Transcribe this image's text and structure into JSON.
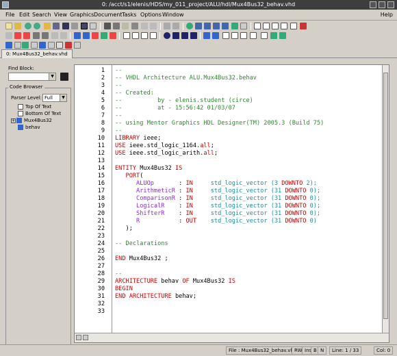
{
  "window": {
    "title": "0: /acct/s1/elenis/HDS/my_011_project/ALU/hdl/Mux4Bus32_behav.vhd"
  },
  "menu": [
    "File",
    "Edit",
    "Search",
    "View",
    "Graphics",
    "Document",
    "Tasks",
    "Options",
    "Window"
  ],
  "menu_help": "Help",
  "tab": {
    "label": "0: Mux4Bus32_behav.vhd"
  },
  "left_panel": {
    "find_block_label": "Find Block:",
    "code_browser_label": "Code Browser",
    "parser_level_label": "Parser Level:",
    "parser_level_value": "Full",
    "tree": [
      {
        "label": "Top Of Text",
        "icon": "page-icon"
      },
      {
        "label": "Bottom Of Text",
        "icon": "page-icon"
      },
      {
        "label": "Mux4Bus32",
        "icon": "entity-icon"
      },
      {
        "label": "behav",
        "icon": "architecture-icon"
      }
    ]
  },
  "editor": {
    "line_numbers": [
      "1",
      "2",
      "3",
      "4",
      "5",
      "6",
      "7",
      "8",
      "9",
      "10",
      "11",
      "12",
      "13",
      "14",
      "15",
      "16",
      "17",
      "18",
      "19",
      "20",
      "21",
      "22",
      "23",
      "24",
      "25",
      "26",
      "27",
      "28",
      "29",
      "30",
      "31",
      "32",
      "33"
    ],
    "lines": [
      [
        [
          "--",
          "com"
        ]
      ],
      [
        [
          "-- VHDL Architecture ALU.Mux4Bus32.behav",
          "com"
        ]
      ],
      [
        [
          "--",
          "com"
        ]
      ],
      [
        [
          "-- Created:",
          "com"
        ]
      ],
      [
        [
          "--          by - elenis.student (circe)",
          "com"
        ]
      ],
      [
        [
          "--          at - 15:56:42 01/03/07",
          "com"
        ]
      ],
      [
        [
          "--",
          "com"
        ]
      ],
      [
        [
          "-- using Mentor Graphics HDL Designer(TM) 2005.3 (Build 75)",
          "com"
        ]
      ],
      [
        [
          "--",
          "com"
        ]
      ],
      [
        [
          "LIBRARY",
          "kw"
        ],
        [
          " ieee;",
          "id"
        ]
      ],
      [
        [
          "USE",
          "kw"
        ],
        [
          " ieee.std_logic_1164.",
          "id"
        ],
        [
          "all",
          "kw"
        ],
        [
          ";",
          "id"
        ]
      ],
      [
        [
          "USE",
          "kw"
        ],
        [
          " ieee.std_logic_arith.",
          "id"
        ],
        [
          "all",
          "kw"
        ],
        [
          ";",
          "id"
        ]
      ],
      [],
      [
        [
          "ENTITY",
          "kw"
        ],
        [
          " Mux4Bus32 ",
          "id"
        ],
        [
          "IS",
          "kw"
        ]
      ],
      [
        [
          "   ",
          "id"
        ],
        [
          "PORT",
          "kw"
        ],
        [
          "(",
          "id"
        ]
      ],
      [
        [
          "      ",
          "id"
        ],
        [
          "ALUOp",
          "pt"
        ],
        [
          "       : ",
          "id"
        ],
        [
          "IN",
          "kw"
        ],
        [
          "     ",
          "id"
        ],
        [
          "std_logic_vector",
          "ty"
        ],
        [
          " (3 ",
          "num"
        ],
        [
          "DOWNTO",
          "kw"
        ],
        [
          " 2);",
          "num"
        ]
      ],
      [
        [
          "      ",
          "id"
        ],
        [
          "ArithmeticR",
          "pt"
        ],
        [
          " : ",
          "id"
        ],
        [
          "IN",
          "kw"
        ],
        [
          "     ",
          "id"
        ],
        [
          "std_logic_vector",
          "ty"
        ],
        [
          " (31 ",
          "num"
        ],
        [
          "DOWNTO",
          "kw"
        ],
        [
          " 0);",
          "num"
        ]
      ],
      [
        [
          "      ",
          "id"
        ],
        [
          "ComparisonR",
          "pt"
        ],
        [
          " : ",
          "id"
        ],
        [
          "IN",
          "kw"
        ],
        [
          "     ",
          "id"
        ],
        [
          "std_logic_vector",
          "ty"
        ],
        [
          " (31 ",
          "num"
        ],
        [
          "DOWNTO",
          "kw"
        ],
        [
          " 0);",
          "num"
        ]
      ],
      [
        [
          "      ",
          "id"
        ],
        [
          "LogicalR",
          "pt"
        ],
        [
          "    : ",
          "id"
        ],
        [
          "IN",
          "kw"
        ],
        [
          "     ",
          "id"
        ],
        [
          "std_logic_vector",
          "ty"
        ],
        [
          " (31 ",
          "num"
        ],
        [
          "DOWNTO",
          "kw"
        ],
        [
          " 0);",
          "num"
        ]
      ],
      [
        [
          "      ",
          "id"
        ],
        [
          "ShifterR",
          "pt"
        ],
        [
          "    : ",
          "id"
        ],
        [
          "IN",
          "kw"
        ],
        [
          "     ",
          "id"
        ],
        [
          "std_logic_vector",
          "ty"
        ],
        [
          " (31 ",
          "num"
        ],
        [
          "DOWNTO",
          "kw"
        ],
        [
          " 0);",
          "num"
        ]
      ],
      [
        [
          "      ",
          "id"
        ],
        [
          "R",
          "pt"
        ],
        [
          "           : ",
          "id"
        ],
        [
          "OUT",
          "kw"
        ],
        [
          "    ",
          "id"
        ],
        [
          "std_logic_vector",
          "ty"
        ],
        [
          " (31 ",
          "num"
        ],
        [
          "DOWNTO",
          "kw"
        ],
        [
          " 0)",
          "num"
        ]
      ],
      [
        [
          "   );",
          "id"
        ]
      ],
      [],
      [
        [
          "-- Declarations",
          "com"
        ]
      ],
      [],
      [
        [
          "END",
          "kw"
        ],
        [
          " Mux4Bus32 ;",
          "id"
        ]
      ],
      [],
      [
        [
          "--",
          "com"
        ]
      ],
      [
        [
          "ARCHITECTURE",
          "kw"
        ],
        [
          " behav ",
          "id"
        ],
        [
          "OF",
          "kw"
        ],
        [
          " Mux4Bus32 ",
          "id"
        ],
        [
          "IS",
          "kw"
        ]
      ],
      [
        [
          "BEGIN",
          "kw"
        ]
      ],
      [
        [
          "END ARCHITECTURE",
          "kw"
        ],
        [
          " behav;",
          "id"
        ]
      ],
      [],
      []
    ]
  },
  "status": {
    "file": "File : Mux4Bus32_behav.vhd",
    "rw": "RW",
    "ins": "Ins",
    "b": "B",
    "n": "N",
    "line": "Line: 1 / 33",
    "col": "Col: 0"
  },
  "colors": {
    "comment": "#2e8b2e",
    "keyword": "#cc0000",
    "type": "#1a8fa0",
    "port": "#8a2be2"
  }
}
